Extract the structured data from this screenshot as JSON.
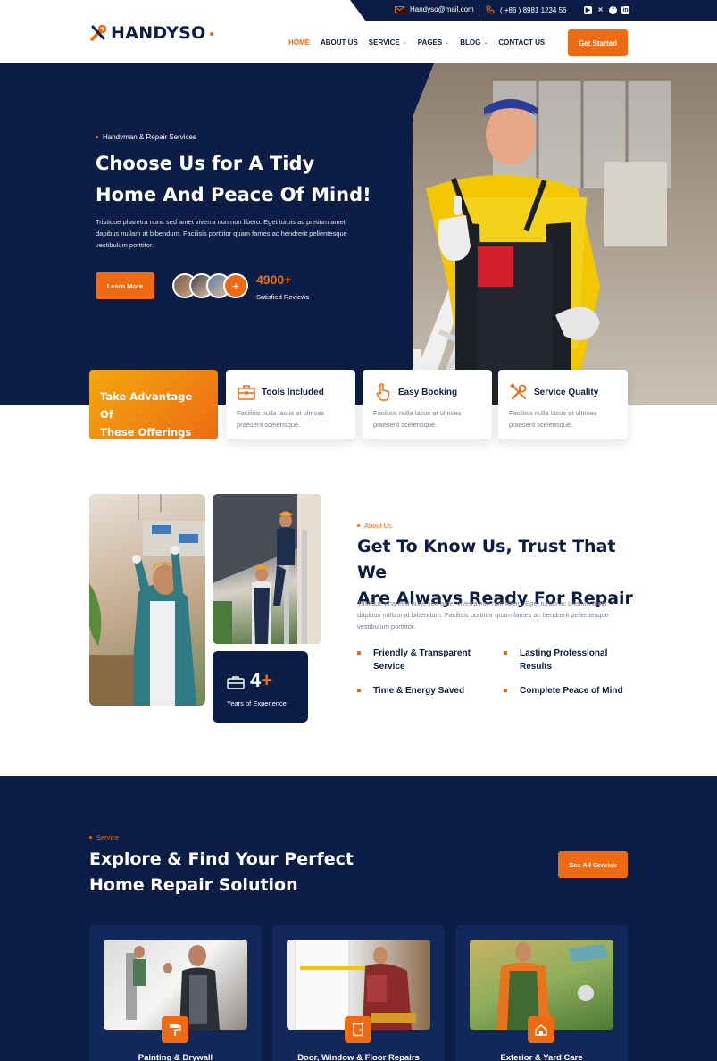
{
  "topbar": {
    "email": "Handyso@mail.com",
    "phone": "( +86 ) 8981 1234 56",
    "socials": [
      "youtube-icon",
      "x-icon",
      "facebook-icon",
      "linkedin-icon"
    ]
  },
  "brand": {
    "name": "HANDYSO",
    "accent": "#ee6a13",
    "navy": "#0c1e45"
  },
  "nav": {
    "items": [
      {
        "label": "HOME",
        "active": true
      },
      {
        "label": "ABOUT US"
      },
      {
        "label": "SERVICE",
        "dropdown": true
      },
      {
        "label": "PAGES",
        "dropdown": true
      },
      {
        "label": "BLOG",
        "dropdown": true
      },
      {
        "label": "CONTACT US"
      }
    ],
    "cta": "Get Started"
  },
  "hero": {
    "eyebrow": "Handyman & Repair Services",
    "title_line1": "Choose Us for A Tidy",
    "title_line2": "Home And Peace Of Mind!",
    "description": "Tristique pharetra nunc sed amet viverra non non libero. Eget turpis ac pretium amet dapibus nullam at bibendum. Facilisis porttitor quam fames ac hendrerit pellentesque vestibulum porttitor.",
    "button": "Learn More",
    "reviews_count": "4900+",
    "reviews_label": "Satisfied Reviews",
    "avatar_plus": "+"
  },
  "offerings": {
    "promo_line1": "Take Advantage Of",
    "promo_line2": "These Offerings",
    "cards": [
      {
        "icon": "toolbox-icon",
        "title": "Tools Included",
        "desc_line1": "Facilisis nulla lacus at ultrices",
        "desc_line2": "praesent scelerisque."
      },
      {
        "icon": "tap-hand-icon",
        "title": "Easy Booking",
        "desc_line1": "Facilisis nulla lacus at ultrices",
        "desc_line2": "praesent scelerisque."
      },
      {
        "icon": "tools-icon",
        "title": "Service Quality",
        "desc_line1": "Facilisis nulla lacus at ultrices",
        "desc_line2": "praesent scelerisque."
      }
    ]
  },
  "about": {
    "eyebrow": "About Us",
    "title_line1": "Get To Know Us, Trust That We",
    "title_line2": "Are Always Ready For Repair",
    "description": "Tristique pharetra nunc sed amet viverra non non libero. Eget turpis ac pretium amet dapibus nullam at bibendum. Facilisis porttitor quam fames ac hendrerit pellentesque vestibulum porttitor.",
    "experience_number": "4",
    "experience_plus": "+",
    "experience_label": "Years of Experience",
    "features": [
      {
        "line1": "Friendly & Transparent",
        "line2": "Service"
      },
      {
        "line1": "Lasting Professional",
        "line2": "Results"
      },
      {
        "line1": "Time & Energy Saved",
        "line2": ""
      },
      {
        "line1": "Complete Peace of Mind",
        "line2": ""
      }
    ]
  },
  "services": {
    "eyebrow": "Service",
    "title_line1": "Explore & Find Your Perfect",
    "title_line2": "Home Repair Solution",
    "button": "See All Service",
    "cards": [
      {
        "name": "Painting & Drywall",
        "icon": "paint-roller-icon"
      },
      {
        "name": "Door, Window & Floor Repairs",
        "icon": "door-icon"
      },
      {
        "name": "Exterior & Yard Care",
        "icon": "house-icon"
      }
    ]
  }
}
